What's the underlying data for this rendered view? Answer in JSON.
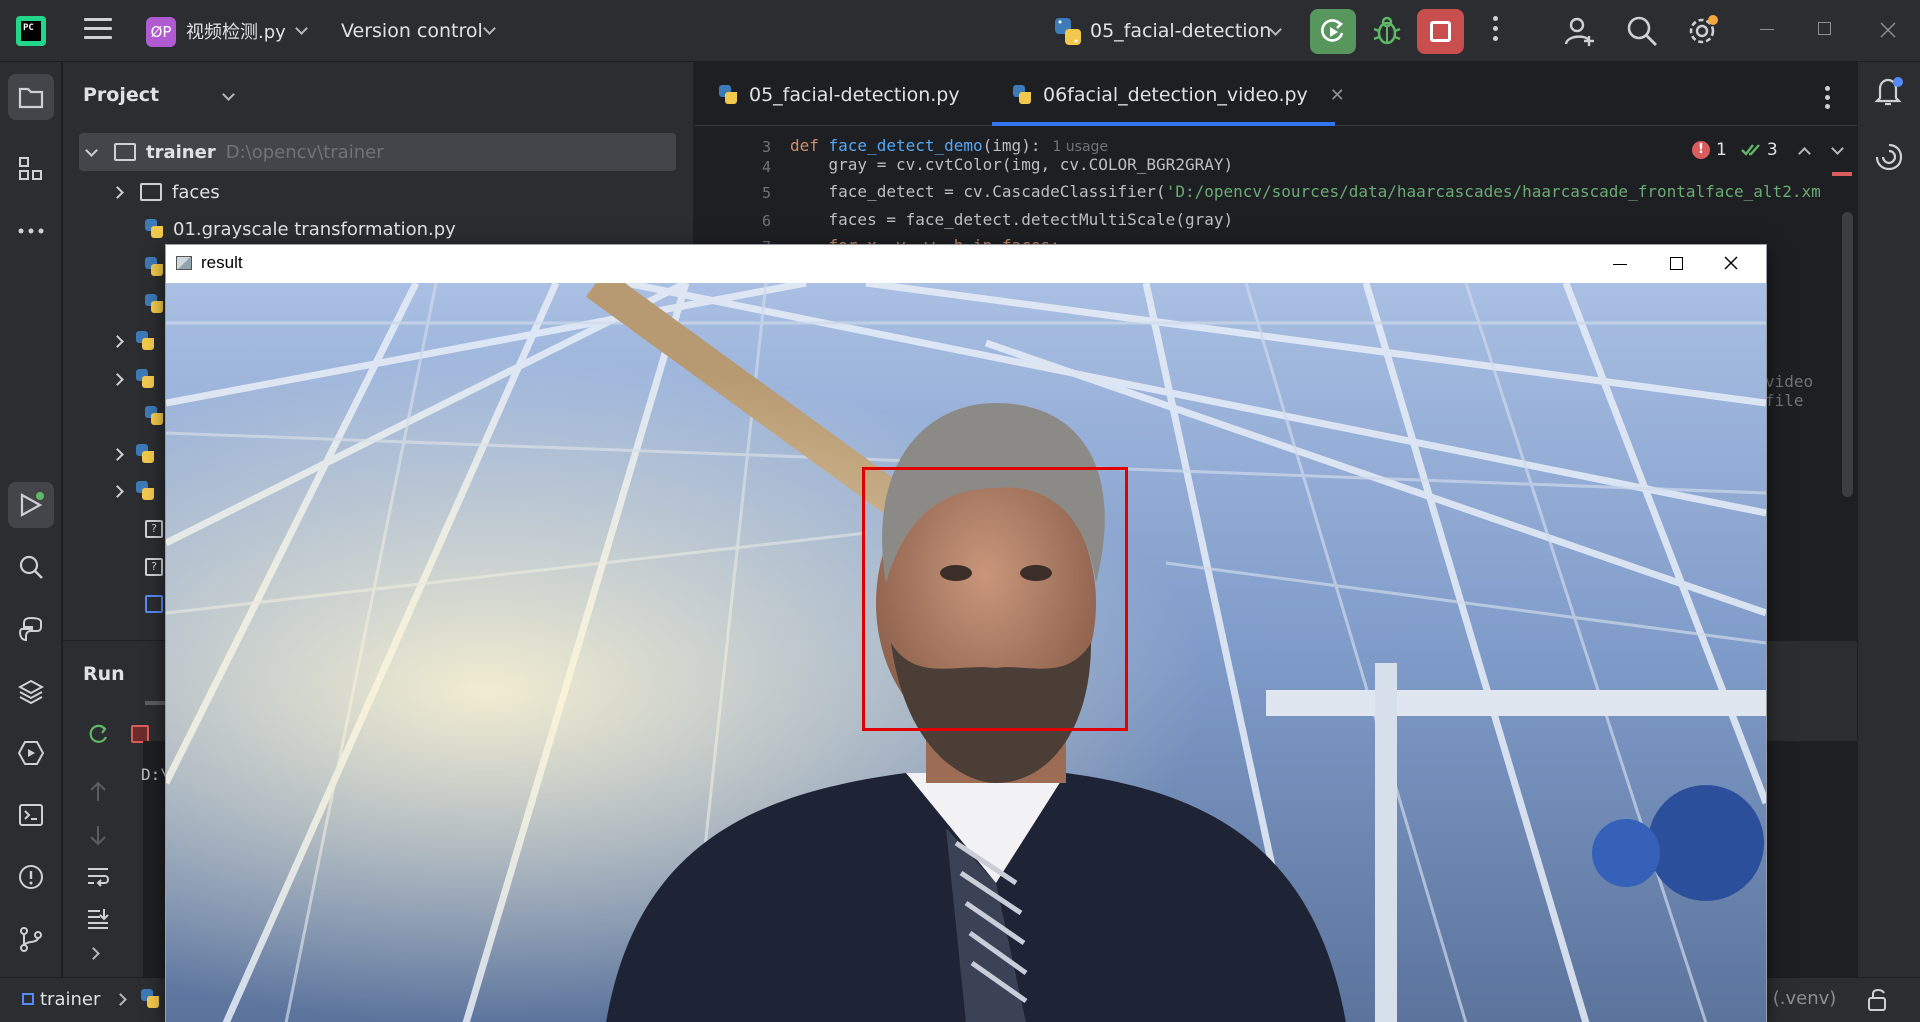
{
  "topbar": {
    "app_logo_text": "PC",
    "project_badge": "ØP",
    "project_name": "视频检测.py",
    "version_control": "Version control",
    "run_config": "05_facial-detection"
  },
  "project_panel": {
    "title": "Project",
    "tree": [
      {
        "label": "trainer",
        "hint": "D:\\opencv\\trainer",
        "type": "folder",
        "expanded": true
      },
      {
        "label": "faces",
        "type": "folder",
        "expanded": false
      },
      {
        "label": "01.grayscale transformation.py",
        "type": "python"
      }
    ]
  },
  "editor": {
    "tabs": [
      {
        "label": "05_facial-detection.py",
        "active": false
      },
      {
        "label": "06facial_detection_video.py",
        "active": true
      }
    ],
    "inspections": {
      "errors": "1",
      "warnings": "3"
    },
    "lines": [
      {
        "num": "3",
        "kw": "def ",
        "fn": "face_detect_demo",
        "rest": "(img):",
        "usage": "1 usage"
      },
      {
        "num": "4",
        "text": "    gray = cv.cvtColor(img, cv.COLOR_BGR2GRAY)"
      },
      {
        "num": "5",
        "pre": "    face_detect = cv.CascadeClassifier(",
        "str": "'D:/opencv/sources/data/haarcascades/haarcascade_frontalface_alt2.xm"
      },
      {
        "num": "6",
        "text": "    faces = face_detect.detectMultiScale(gray)"
      },
      {
        "num": "7",
        "text": "    for x, y, w, h in faces:"
      }
    ],
    "partial_text": "video file"
  },
  "run_panel": {
    "title": "Run",
    "console_line": "D:\\"
  },
  "statusbar": {
    "breadcrumb": "trainer",
    "interpreter": ") (.venv)"
  },
  "cv_window": {
    "title": "result"
  },
  "colors": {
    "accent": "#3574f0",
    "run_green": "#57965c",
    "stop_red": "#c94f4f",
    "detection_box": "#e00000"
  }
}
